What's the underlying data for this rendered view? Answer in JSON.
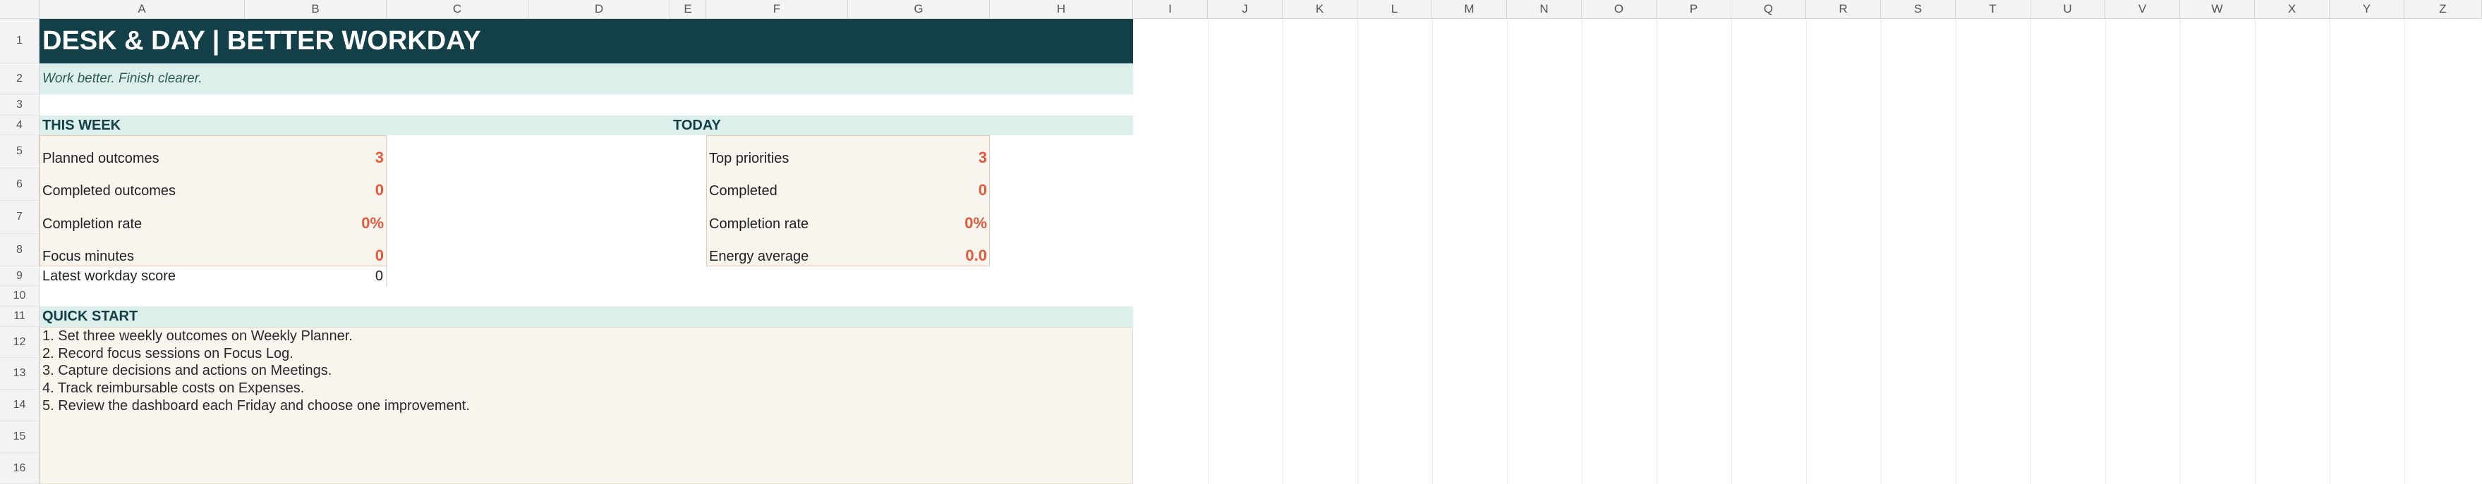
{
  "columns": [
    "A",
    "B",
    "C",
    "D",
    "E",
    "F",
    "G",
    "H",
    "I",
    "J",
    "K",
    "L",
    "M",
    "N",
    "O",
    "P",
    "Q",
    "R",
    "S",
    "T",
    "U",
    "V",
    "W",
    "X",
    "Y",
    "Z"
  ],
  "rows": [
    "1",
    "2",
    "3",
    "4",
    "5",
    "6",
    "7",
    "8",
    "9",
    "10",
    "11",
    "12",
    "13",
    "14",
    "15",
    "16"
  ],
  "sheet": {
    "title": "DESK & DAY | BETTER WORKDAY",
    "subtitle": "Work better. Finish clearer."
  },
  "this_week": {
    "heading": "THIS WEEK",
    "items": [
      {
        "label": "Planned outcomes",
        "value": "3"
      },
      {
        "label": "Completed outcomes",
        "value": "0"
      },
      {
        "label": "Completion rate",
        "value": "0%"
      },
      {
        "label": "Focus minutes",
        "value": "0"
      }
    ],
    "latest_label": "Latest workday score",
    "latest_value": "0"
  },
  "today": {
    "heading": "TODAY",
    "items": [
      {
        "label": "Top priorities",
        "value": "3"
      },
      {
        "label": "Completed",
        "value": "0"
      },
      {
        "label": "Completion rate",
        "value": "0%"
      },
      {
        "label": "Energy average",
        "value": "0.0"
      }
    ]
  },
  "quick_start": {
    "heading": "QUICK START",
    "steps": [
      "1. Set three weekly outcomes on Weekly Planner.",
      "2. Record focus sessions on Focus Log.",
      "3. Capture decisions and actions on Meetings.",
      "4. Track reimbursable costs on Expenses.",
      "5. Review the dashboard each Friday and choose one improvement."
    ]
  },
  "colors": {
    "title_bg": "#123f48",
    "band_bg": "#dcefeb",
    "kpi_bg": "#f8f5ef",
    "accent_value": "#e45a3a"
  }
}
